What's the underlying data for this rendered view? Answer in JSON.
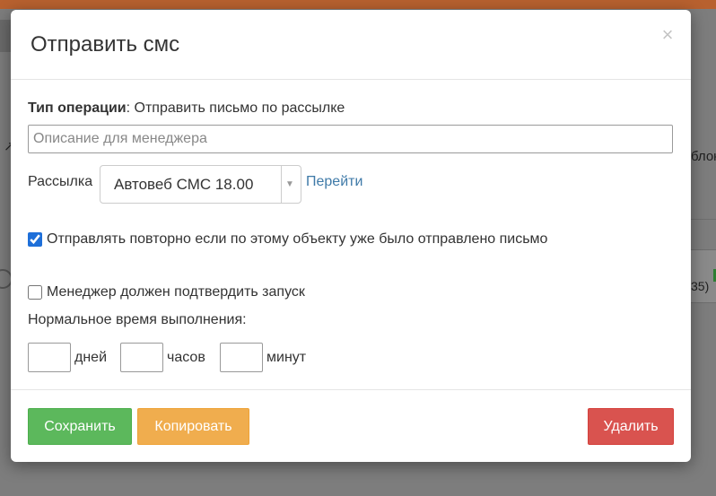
{
  "background": {
    "right_text": "блок",
    "right_count": "35)"
  },
  "modal": {
    "title": "Отправить смс",
    "close_symbol": "×",
    "operation": {
      "label": "Тип операции",
      "separator": ": ",
      "value": "Отправить письмо по рассылке"
    },
    "description_input": {
      "placeholder": "Описание для менеджера",
      "value": ""
    },
    "mailing": {
      "label": "Рассылка",
      "selected": "Автовеб СМС 18.00",
      "go_link": "Перейти"
    },
    "resend_checkbox": {
      "label": "Отправлять повторно если по этому объекту уже было отправлено письмо",
      "checked": true
    },
    "confirm_checkbox": {
      "label": "Менеджер должен подтвердить запуск",
      "checked": false
    },
    "normal_time": {
      "label": "Нормальное время выполнения:",
      "days_label": "дней",
      "hours_label": "часов",
      "minutes_label": "минут",
      "days_value": "",
      "hours_value": "",
      "minutes_value": ""
    },
    "footer": {
      "save_label": "Сохранить",
      "copy_label": "Копировать",
      "delete_label": "Удалить"
    }
  },
  "colors": {
    "save": "#5cb85c",
    "copy": "#f0ad4e",
    "delete": "#d9534f",
    "link": "#3f7aa8",
    "top_bar": "#b8612f"
  }
}
